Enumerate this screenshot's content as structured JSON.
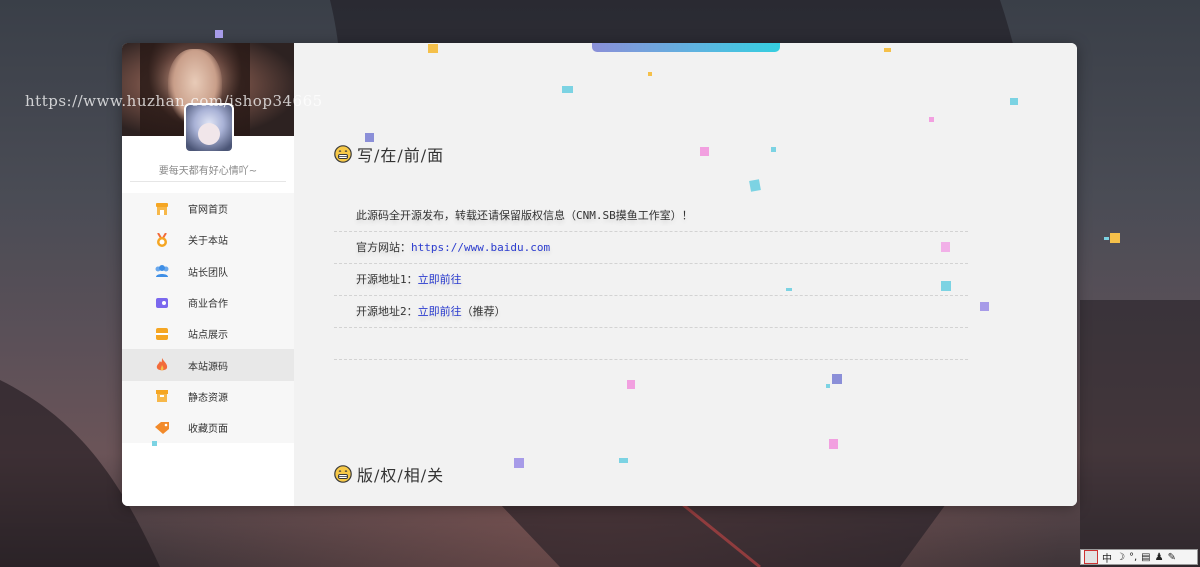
{
  "watermark": "https://www.huzhan.com/ishop34665",
  "sidebar": {
    "motto": "要每天都有好心情吖~",
    "items": [
      {
        "label": "官网首页",
        "icon": "store-icon",
        "color": "#f5a623"
      },
      {
        "label": "关于本站",
        "icon": "medal-icon",
        "color": "#f5a623"
      },
      {
        "label": "站长团队",
        "icon": "team-icon",
        "color": "#3f8fe6"
      },
      {
        "label": "商业合作",
        "icon": "wallet-icon",
        "color": "#7b68ee"
      },
      {
        "label": "站点展示",
        "icon": "archive-icon",
        "color": "#f5a623"
      },
      {
        "label": "本站源码",
        "icon": "fire-icon",
        "color": "#f26b3a"
      },
      {
        "label": "静态资源",
        "icon": "box-icon",
        "color": "#f5a623"
      },
      {
        "label": "收藏页面",
        "icon": "tags-icon",
        "color": "#f28a2a"
      }
    ],
    "active_index": 5
  },
  "content": {
    "section1_title": "写/在/前/面",
    "rows": {
      "notice": "此源码全开源发布，转载还请保留版权信息（CNM.SB摸鱼工作室）！",
      "website_label": "官方网站：",
      "website_url": "https://www.baidu.com",
      "source1_label": "开源地址1：",
      "source1_link": "立即前往",
      "source2_label": "开源地址2：",
      "source2_link": "立即前往",
      "source2_note": "（推荐）"
    },
    "section2_title": "版/权/相/关"
  },
  "tray": {
    "ime": "中",
    "moon": "☽",
    "punct": "°,",
    "keyboard": "▤",
    "user": "♟",
    "tools": "✎"
  },
  "colors": {
    "accent_gradient_start": "#8b8fd8",
    "accent_gradient_end": "#35cfe0",
    "link": "#2b3ccf"
  }
}
